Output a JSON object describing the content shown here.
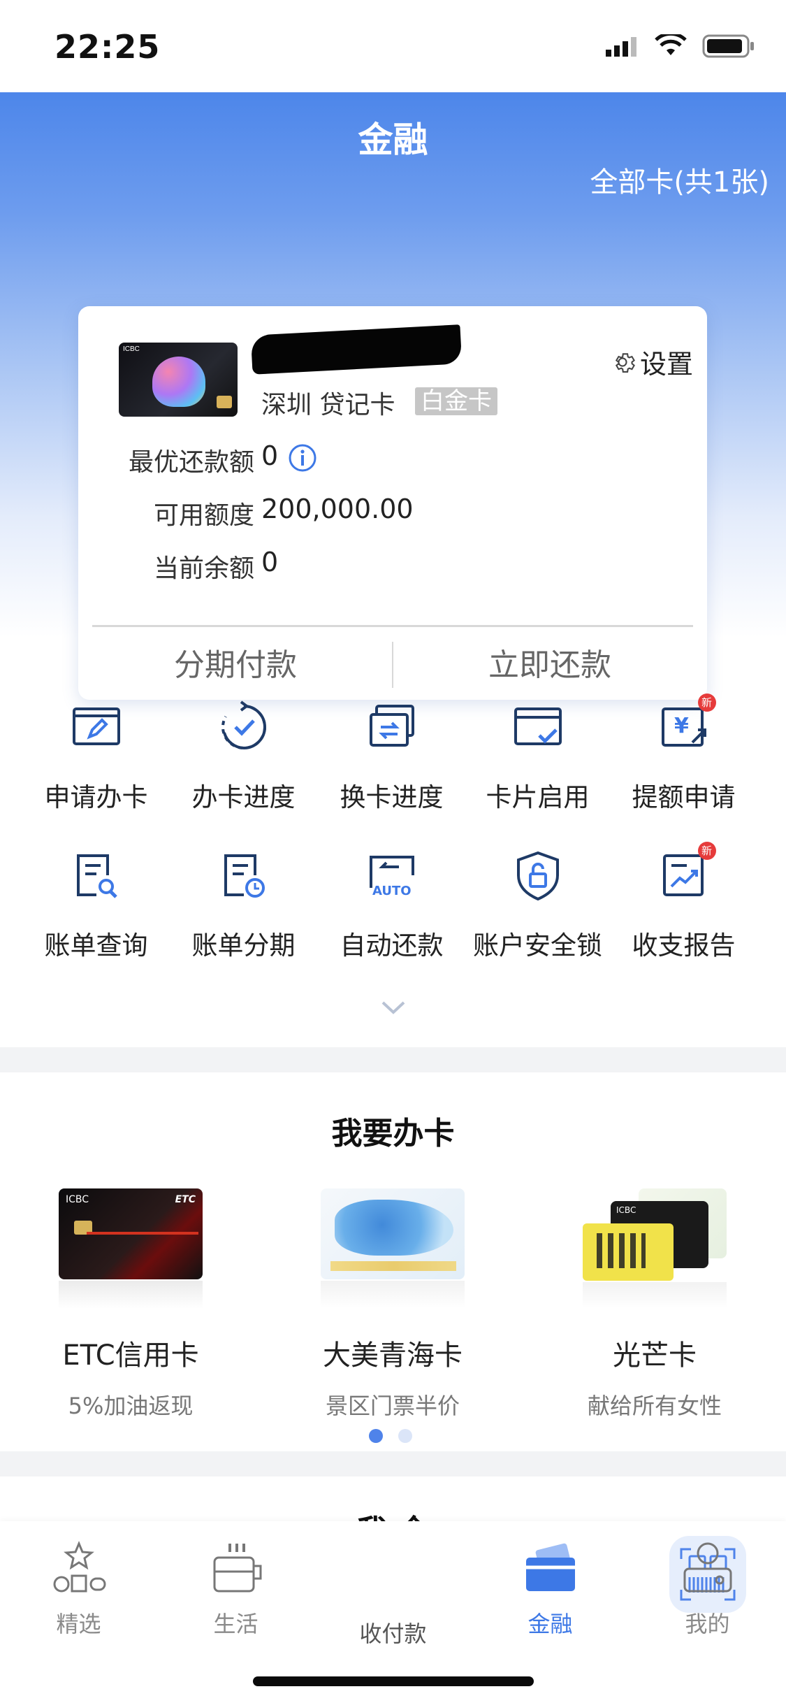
{
  "status_bar": {
    "time": "22:25"
  },
  "header": {
    "title": "金融",
    "all_cards": "全部卡(共1张)"
  },
  "card": {
    "name": "深圳 贷记卡",
    "badge": "白金卡",
    "settings_label": "设置",
    "rows": [
      {
        "label": "最优还款额",
        "value": "0"
      },
      {
        "label": "可用额度",
        "value": "200,000.00"
      },
      {
        "label": "当前余额",
        "value": "0"
      }
    ],
    "actions": {
      "installment": "分期付款",
      "repay": "立即还款"
    }
  },
  "services": [
    {
      "label": "申请办卡",
      "icon": "apply-card-icon"
    },
    {
      "label": "办卡进度",
      "icon": "progress-check-icon"
    },
    {
      "label": "换卡进度",
      "icon": "card-replace-icon"
    },
    {
      "label": "卡片启用",
      "icon": "card-activate-icon"
    },
    {
      "label": "提额申请",
      "icon": "limit-increase-icon",
      "badge": "新"
    },
    {
      "label": "账单查询",
      "icon": "bill-search-icon"
    },
    {
      "label": "账单分期",
      "icon": "bill-installment-icon"
    },
    {
      "label": "自动还款",
      "icon": "auto-repay-icon",
      "icon_text": "AUTO"
    },
    {
      "label": "账户安全锁",
      "icon": "security-lock-icon"
    },
    {
      "label": "收支报告",
      "icon": "report-icon",
      "badge": "新"
    }
  ],
  "apply_section": {
    "title": "我要办卡",
    "cards": [
      {
        "name": "ETC信用卡",
        "desc": "5%加油返现"
      },
      {
        "name": "大美青海卡",
        "desc": "景区门票半价"
      },
      {
        "name": "光芒卡",
        "desc": "献给所有女性"
      }
    ],
    "page_count": 2,
    "active_page": 1
  },
  "next_section_peek": "我 全",
  "tabbar": {
    "tabs": [
      {
        "label": "精选"
      },
      {
        "label": "生活"
      },
      {
        "label": "收付款"
      },
      {
        "label": "金融"
      },
      {
        "label": "我的"
      }
    ],
    "active_tab": "金融"
  },
  "colors": {
    "brand_blue": "#3d78e6",
    "badge_red": "#e63b3b",
    "icon_navy": "#1e3a66"
  }
}
